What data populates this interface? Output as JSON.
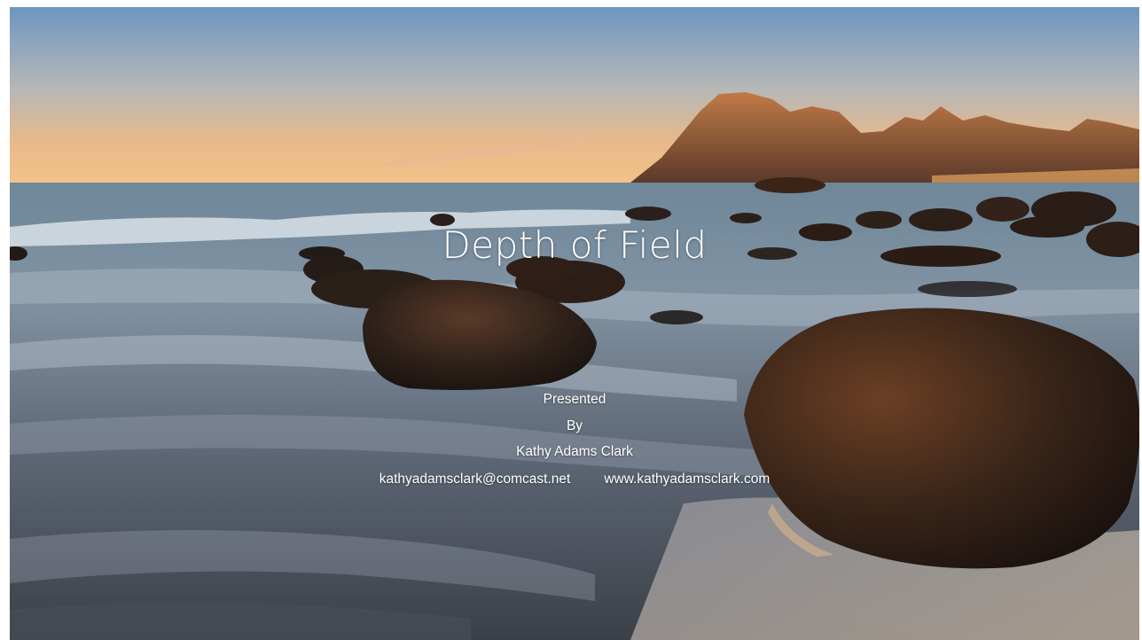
{
  "slide": {
    "title": "Depth of Field",
    "line1": "Presented",
    "line2": "By",
    "line3": "Kathy Adams Clark",
    "email": "kathyadamsclark@comcast.net",
    "website": "www.kathyadamsclark.com"
  },
  "background": {
    "subject": "seascape-photo"
  }
}
